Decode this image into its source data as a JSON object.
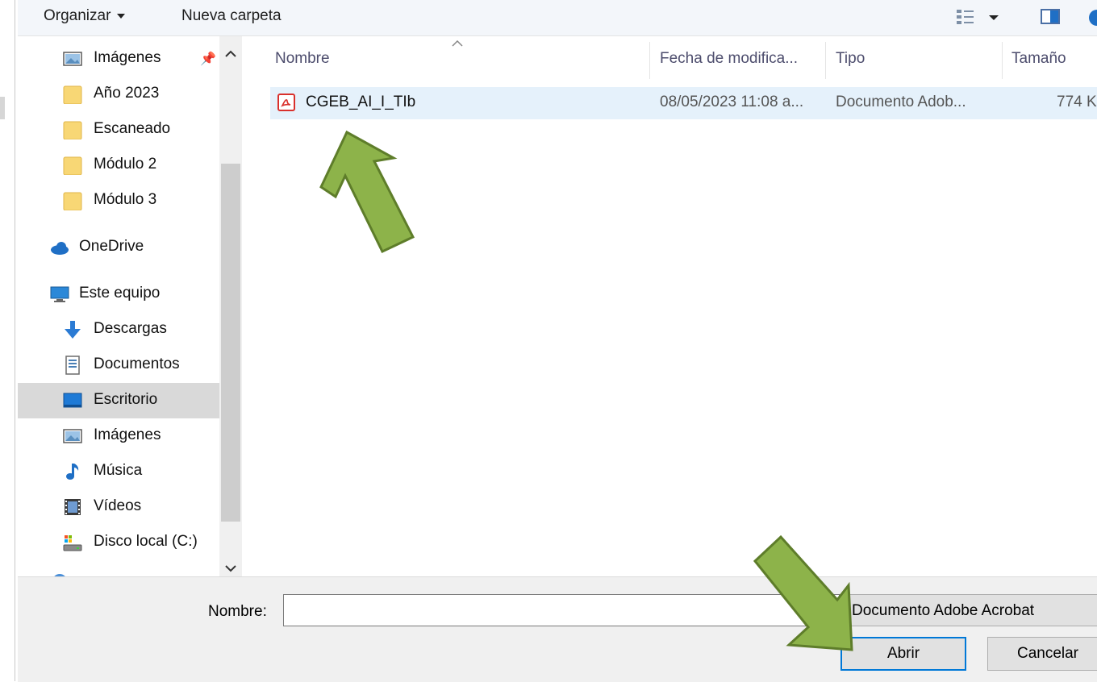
{
  "toolbar": {
    "organize_label": "Organizar",
    "new_folder_label": "Nueva carpeta"
  },
  "nav": {
    "items": [
      {
        "label": "Imágenes",
        "icon": "pictures-icon",
        "pinned": true
      },
      {
        "label": "Año 2023",
        "icon": "folder-icon"
      },
      {
        "label": "Escaneado",
        "icon": "folder-icon"
      },
      {
        "label": "Módulo 2",
        "icon": "folder-icon"
      },
      {
        "label": "Módulo 3",
        "icon": "folder-icon"
      },
      {
        "label": "OneDrive",
        "icon": "cloud-icon"
      },
      {
        "label": "Este equipo",
        "icon": "computer-icon"
      },
      {
        "label": "Descargas",
        "icon": "download-icon"
      },
      {
        "label": "Documentos",
        "icon": "documents-icon"
      },
      {
        "label": "Escritorio",
        "icon": "desktop-icon",
        "selected": true
      },
      {
        "label": "Imágenes",
        "icon": "pictures-icon"
      },
      {
        "label": "Música",
        "icon": "music-icon"
      },
      {
        "label": "Vídeos",
        "icon": "videos-icon"
      },
      {
        "label": "Disco local (C:)",
        "icon": "drive-icon"
      }
    ]
  },
  "file_list": {
    "columns": [
      "Nombre",
      "Fecha de modifica...",
      "Tipo",
      "Tamaño"
    ],
    "rows": [
      {
        "name": "CGEB_AI_I_TIb",
        "modified": "08/05/2023 11:08 a...",
        "type": "Documento Adob...",
        "size": "774 K",
        "icon": "pdf-icon"
      }
    ]
  },
  "bottom": {
    "filename_label": "Nombre:",
    "filename_value": "",
    "filetype_value": "Documento Adobe Acrobat",
    "open_label": "Abrir",
    "cancel_label": "Cancelar"
  },
  "colors": {
    "accent": "#0078d7",
    "arrow_fill": "#8db34a",
    "arrow_stroke": "#5e7d2a",
    "folder": "#f8d775",
    "pdf": "#d9302c"
  }
}
